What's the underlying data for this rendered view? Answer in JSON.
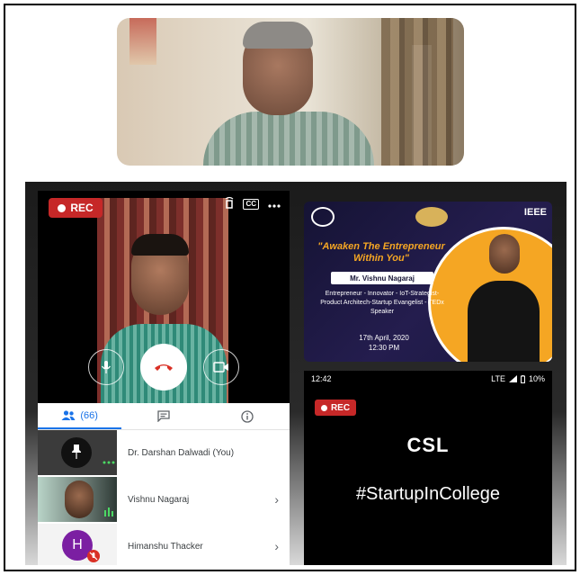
{
  "colors": {
    "rec": "#c62828",
    "accent": "#1a73e8",
    "poster_bg": "#1b1840",
    "poster_accent": "#f5a623"
  },
  "call": {
    "rec_label": "REC",
    "cc_label": "CC",
    "icons": [
      "cast-icon",
      "cc-icon",
      "more-icon",
      "mic-icon",
      "end-call-icon",
      "camera-icon"
    ]
  },
  "participants": {
    "tab_count": "(66)",
    "tabs": [
      "people-icon",
      "chat-icon",
      "info-icon"
    ],
    "list": [
      {
        "name": "Dr. Darshan Dalwadi (You)"
      },
      {
        "name": "Vishnu Nagaraj"
      },
      {
        "name": "Himanshu Thacker",
        "initial": "H"
      }
    ]
  },
  "poster": {
    "ieee": "IEEE",
    "title": "\"Awaken The Entrepreneur Within You\"",
    "speaker": "Mr. Vishnu Nagaraj",
    "roles": "Entrepreneur - Innovator - IoT-Strategist- Product Architech-Startup Evangelist - TEDx Speaker",
    "date_day": "17th April, 2020",
    "time": "12:30 PM"
  },
  "phone": {
    "time": "12:42",
    "network": "LTE",
    "battery": "10%",
    "rec_label": "REC",
    "logo": "CSL",
    "hashtag": "#StartupInCollege"
  }
}
